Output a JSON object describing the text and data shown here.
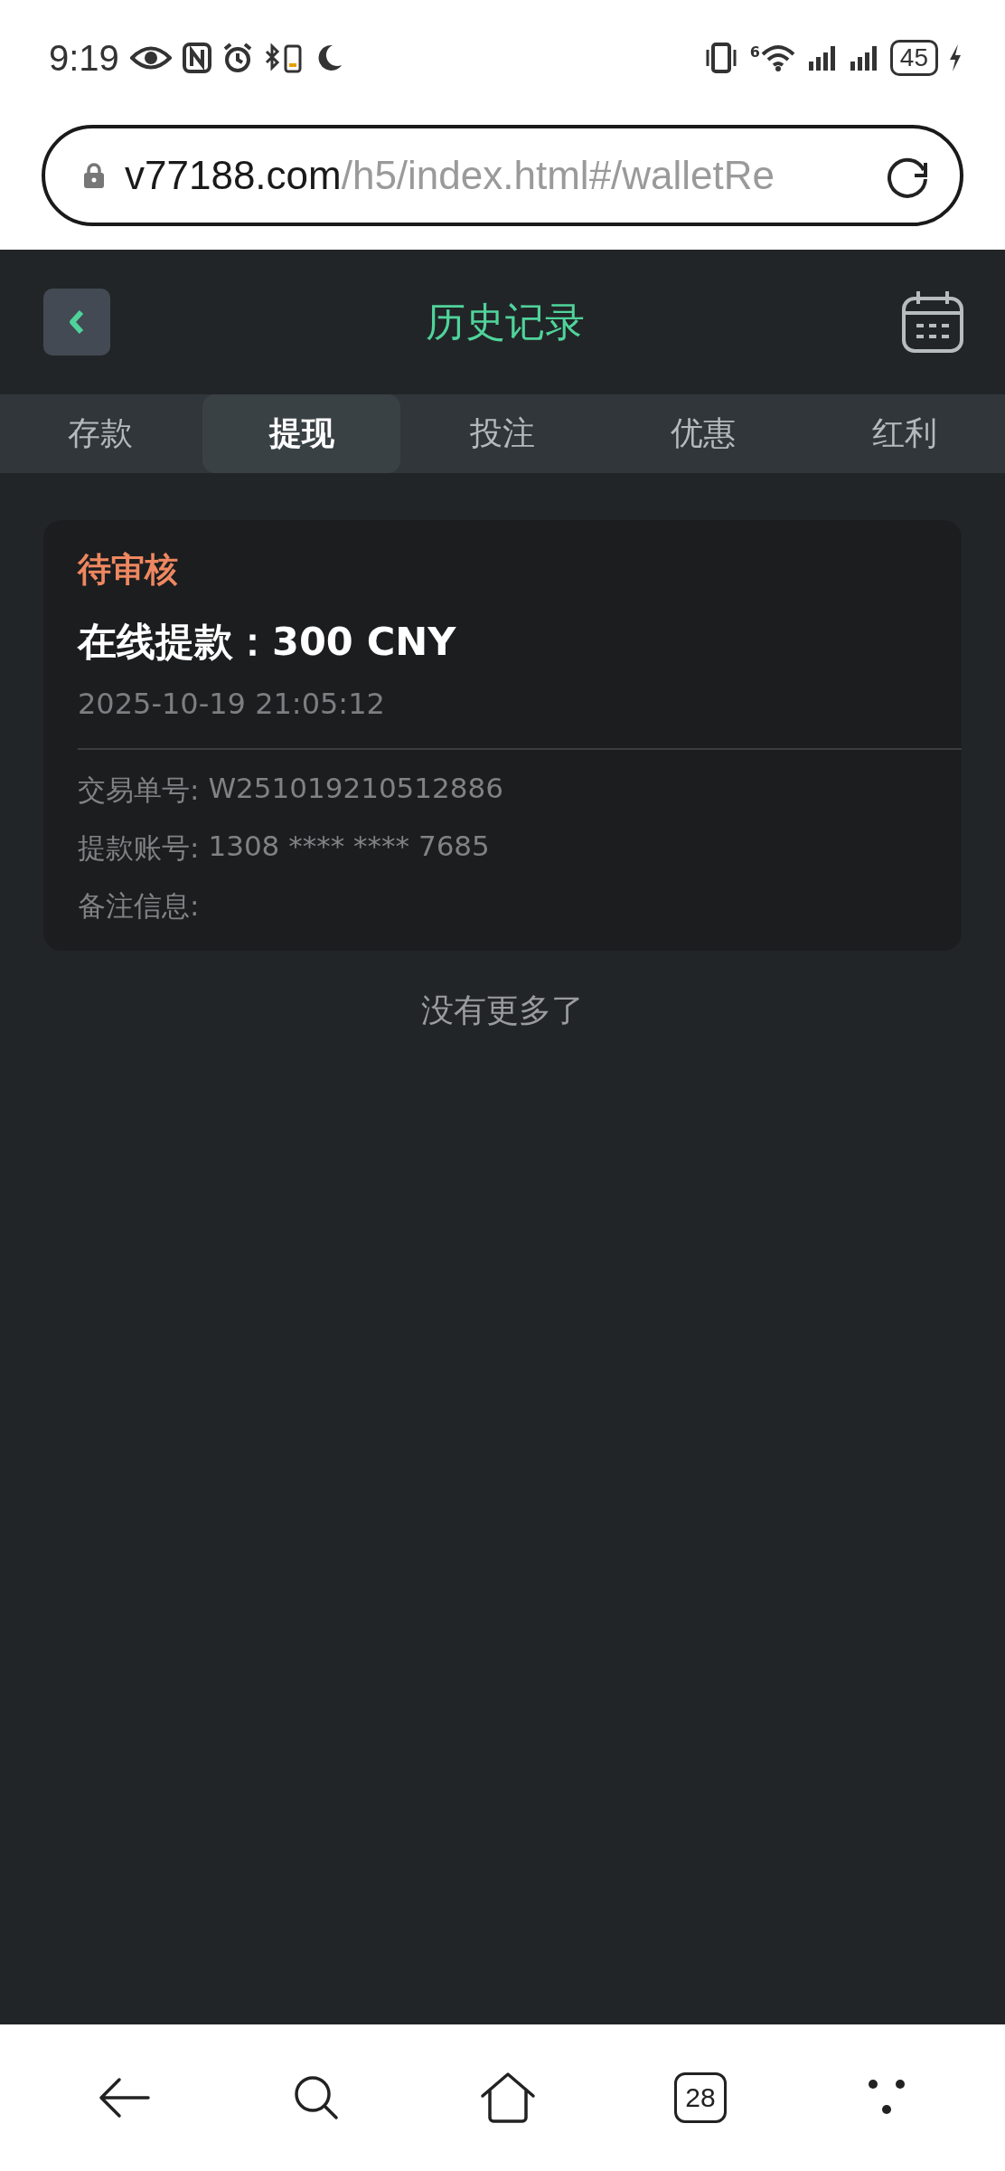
{
  "status_bar": {
    "time": "9:19",
    "battery": "45",
    "network": "6"
  },
  "address_bar": {
    "domain": "v77188.com",
    "path": "/h5/index.html#/walletRe"
  },
  "header": {
    "title": "历史记录"
  },
  "tabs": [
    {
      "label": "存款",
      "selected": false
    },
    {
      "label": "提现",
      "selected": true
    },
    {
      "label": "投注",
      "selected": false
    },
    {
      "label": "优惠",
      "selected": false
    },
    {
      "label": "红利",
      "selected": false
    }
  ],
  "records": [
    {
      "status": "待审核",
      "title": "在线提款：300 CNY",
      "time": "2025-10-19 21:05:12",
      "details": [
        {
          "label": "交易单号:",
          "value": "W251019210512886"
        },
        {
          "label": "提款账号:",
          "value": "1308 **** **** 7685"
        },
        {
          "label": "备注信息:"
        }
      ]
    }
  ],
  "end_text": "没有更多了",
  "browser_nav": {
    "tab_count": "28"
  }
}
